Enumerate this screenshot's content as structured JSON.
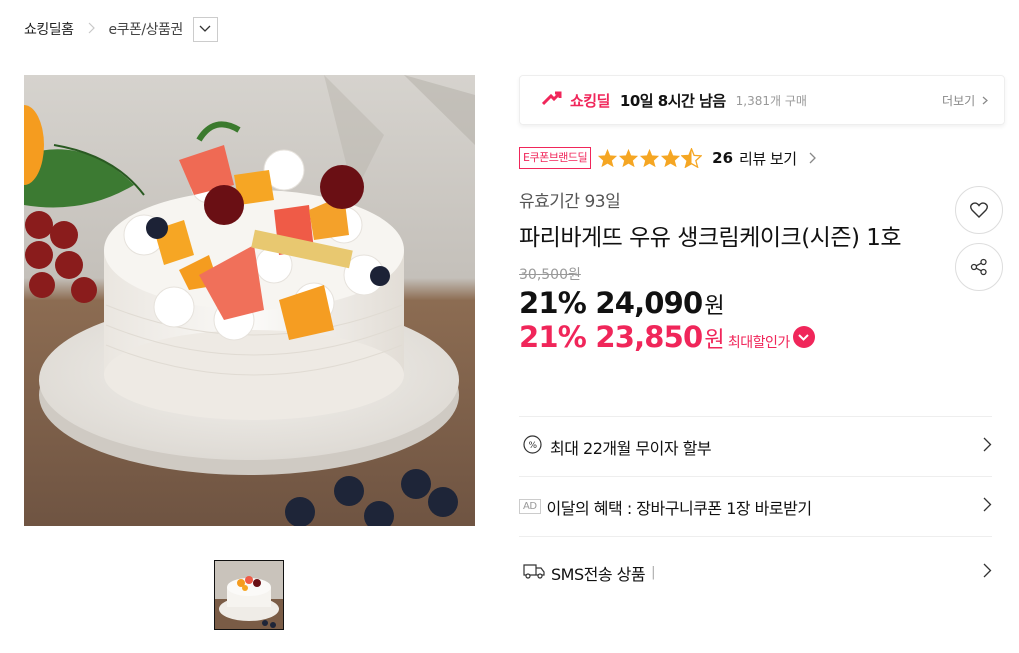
{
  "breadcrumb": {
    "home": "쇼킹딜홈",
    "category": "e쿠폰/상품권"
  },
  "deal": {
    "brand": "쇼킹딜",
    "time_left": "10일 8시간 남음",
    "count": "1,381개 구매",
    "more": "더보기"
  },
  "product": {
    "brand_badge": "E쿠폰브랜드딜",
    "rating": 4.5,
    "review_count": "26",
    "review_label": "리뷰 보기",
    "validity": "유효기간 93일",
    "title": "파리바게뜨 우유 생크림케이크(시즌) 1호",
    "original_price": "30,500원",
    "price": {
      "discount": "21%",
      "amount": "24,090",
      "unit": "원"
    },
    "max_price": {
      "discount": "21%",
      "amount": "23,850",
      "unit": "원",
      "label": "최대할인가"
    }
  },
  "benefits": [
    {
      "icon": "percent-icon",
      "label": "최대 22개월 무이자 할부"
    },
    {
      "icon": "ad-badge",
      "badge": "AD",
      "label": "이달의 혜택 : 장바구니쿠폰 1장 바로받기"
    },
    {
      "icon": "delivery-truck-icon",
      "label": "SMS전송 상품",
      "divider": "|"
    }
  ],
  "colors": {
    "accent": "#f0265a",
    "star": "#f5a623"
  }
}
